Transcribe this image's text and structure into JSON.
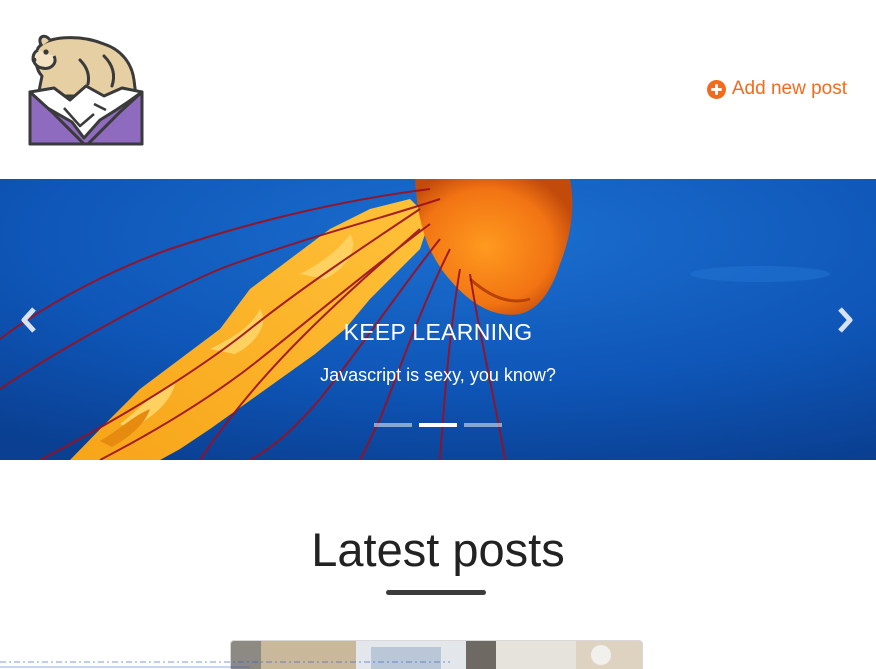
{
  "header": {
    "add_post_label": "Add new post",
    "accent_color": "#f26b1d",
    "logo_icon": "polar-bear-logo-icon",
    "add_icon": "plus-circle-icon"
  },
  "carousel": {
    "title": "KEEP LEARNING",
    "text": "Javascript is sexy, you know?",
    "slide_count": 3,
    "active_slide": 2,
    "prev_icon": "chevron-left-icon",
    "next_icon": "chevron-right-icon"
  },
  "latest": {
    "title": "Latest posts"
  }
}
